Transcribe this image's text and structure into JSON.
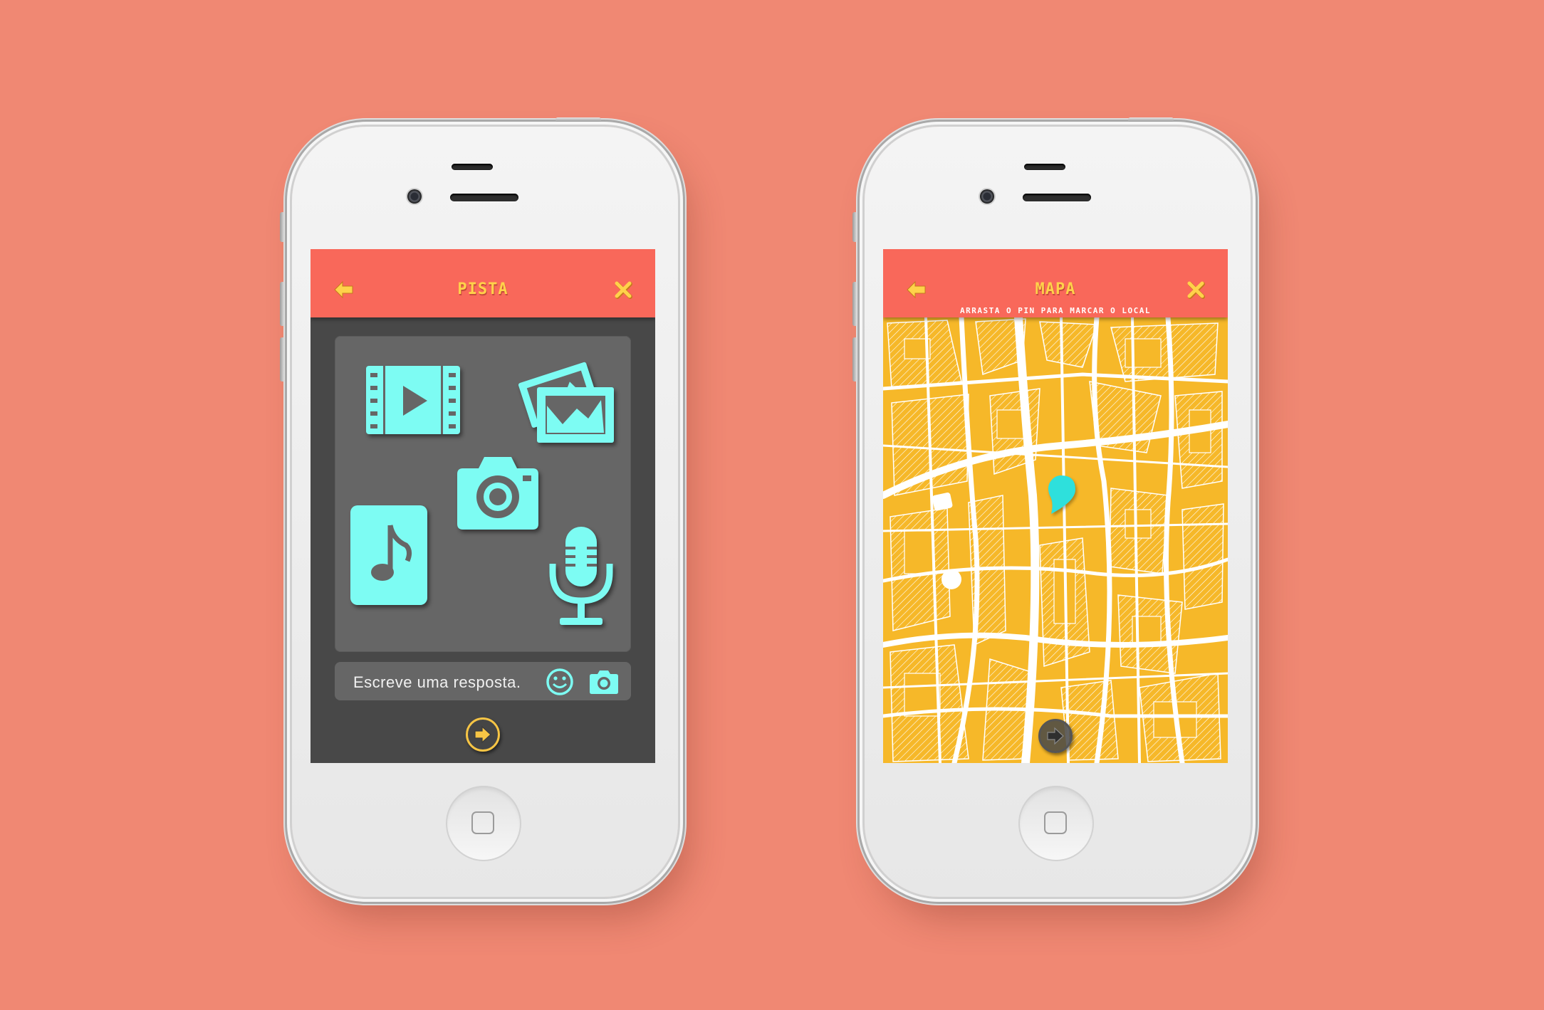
{
  "colors": {
    "background": "#f08873",
    "header": "#f9685a",
    "header_text": "#ffd24a",
    "icon_accent": "#7dfcf3",
    "screen_bg": "#484848",
    "panel_bg": "#666666",
    "map_fill": "#f6b829",
    "pin": "#2ee0dc"
  },
  "screen_pista": {
    "title": "PISTA",
    "back_icon": "arrow-left-icon",
    "close_icon": "close-icon",
    "media_icons": [
      "video-icon",
      "photos-icon",
      "camera-icon",
      "music-note-icon",
      "microphone-icon"
    ],
    "answer_placeholder": "Escreve uma resposta.",
    "answer_icons": [
      "smiley-icon",
      "camera-icon"
    ],
    "next_icon": "arrow-right-circle-icon"
  },
  "screen_mapa": {
    "title": "MAPA",
    "subtitle": "ARRASTA O PIN PARA MARCAR O LOCAL",
    "back_icon": "arrow-left-icon",
    "close_icon": "close-icon",
    "pin_icon": "map-pin-icon",
    "next_icon": "arrow-right-circle-icon"
  }
}
